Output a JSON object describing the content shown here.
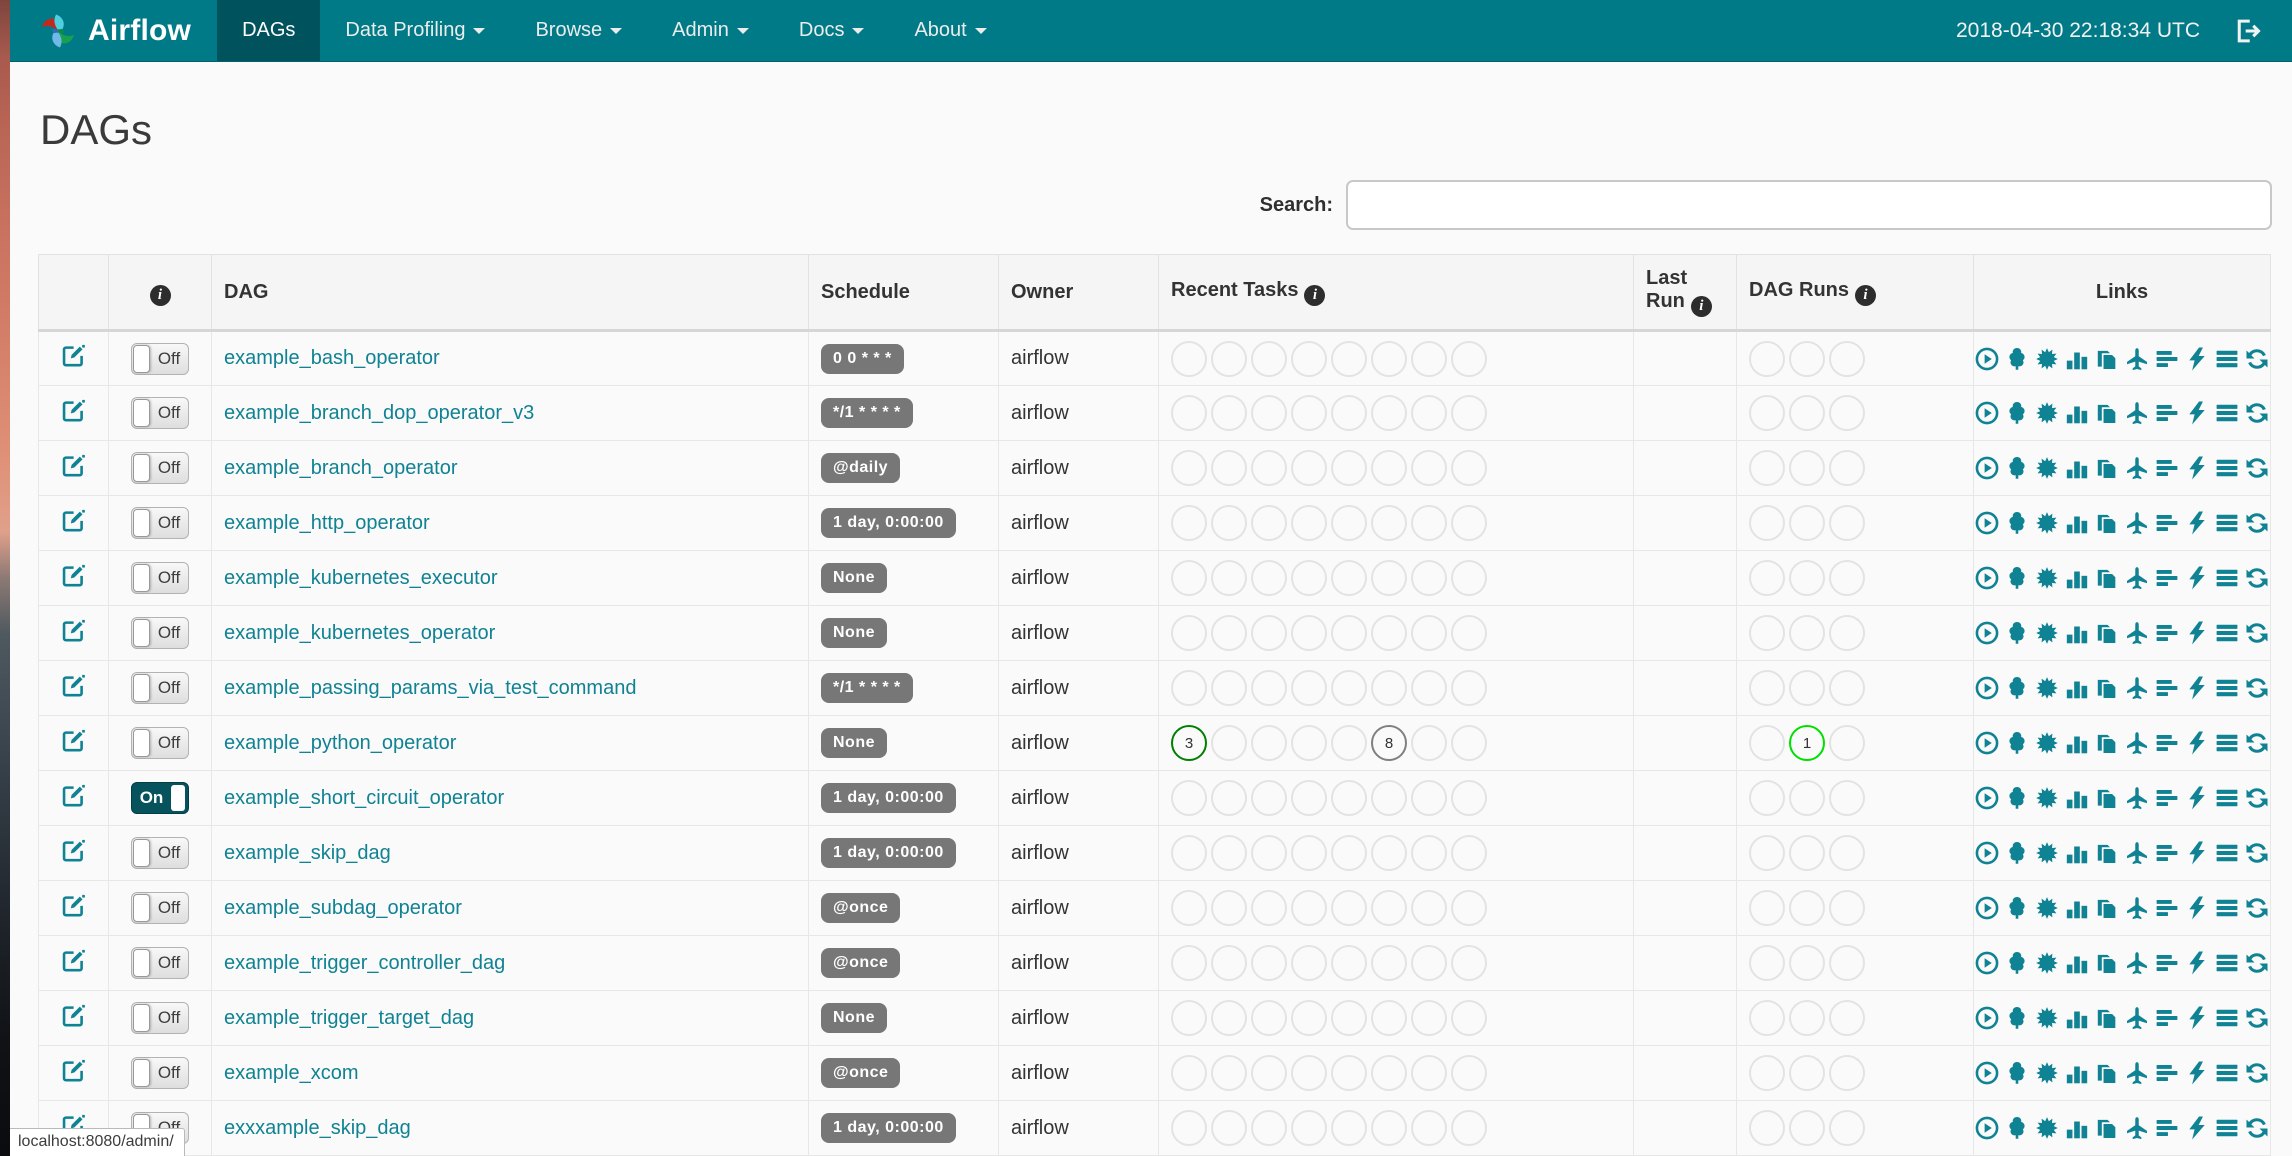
{
  "colors": {
    "navbar_bg": "#007a87",
    "navbar_active_bg": "#00525c",
    "accent_link": "#0f8293",
    "schedule_badge_bg": "#777777",
    "state_success": "#008000",
    "state_queued": "#808080",
    "state_running": "#00e000",
    "empty_circle_border": "#e3e3e3"
  },
  "navbar": {
    "brand": "Airflow",
    "logo_icon": "airflow-pinwheel-logo",
    "items": [
      {
        "label": "DAGs",
        "active": true,
        "caret": false
      },
      {
        "label": "Data Profiling",
        "active": false,
        "caret": true
      },
      {
        "label": "Browse",
        "active": false,
        "caret": true
      },
      {
        "label": "Admin",
        "active": false,
        "caret": true
      },
      {
        "label": "Docs",
        "active": false,
        "caret": true
      },
      {
        "label": "About",
        "active": false,
        "caret": true
      }
    ],
    "clock": "2018-04-30 22:18:34 UTC",
    "logout_icon": "sign-out"
  },
  "page": {
    "title": "DAGs",
    "search_label": "Search:",
    "search_value": "",
    "status_bar": "localhost:8080/admin/"
  },
  "table": {
    "headers": {
      "edit": "",
      "info_icon": "info-circle",
      "dag": "DAG",
      "schedule": "Schedule",
      "owner": "Owner",
      "recent_tasks": "Recent Tasks",
      "last_run": "Last Run",
      "dag_runs": "DAG Runs",
      "links": "Links"
    },
    "toggle_on_label": "On",
    "toggle_off_label": "Off",
    "link_icons": [
      "trigger-dag",
      "tree-view",
      "graph-view",
      "task-duration",
      "task-tries",
      "landing-times",
      "gantt",
      "code",
      "logs",
      "refresh"
    ],
    "rows": [
      {
        "dag_id": "example_bash_operator",
        "toggle": "Off",
        "schedule": "0 0 * * *",
        "owner": "airflow",
        "recent_tasks": [
          null,
          null,
          null,
          null,
          null,
          null,
          null,
          null
        ],
        "last_run": "",
        "dag_runs": [
          null,
          null,
          null
        ]
      },
      {
        "dag_id": "example_branch_dop_operator_v3",
        "toggle": "Off",
        "schedule": "*/1 * * * *",
        "owner": "airflow",
        "recent_tasks": [
          null,
          null,
          null,
          null,
          null,
          null,
          null,
          null
        ],
        "last_run": "",
        "dag_runs": [
          null,
          null,
          null
        ]
      },
      {
        "dag_id": "example_branch_operator",
        "toggle": "Off",
        "schedule": "@daily",
        "owner": "airflow",
        "recent_tasks": [
          null,
          null,
          null,
          null,
          null,
          null,
          null,
          null
        ],
        "last_run": "",
        "dag_runs": [
          null,
          null,
          null
        ]
      },
      {
        "dag_id": "example_http_operator",
        "toggle": "Off",
        "schedule": "1 day, 0:00:00",
        "owner": "airflow",
        "recent_tasks": [
          null,
          null,
          null,
          null,
          null,
          null,
          null,
          null
        ],
        "last_run": "",
        "dag_runs": [
          null,
          null,
          null
        ]
      },
      {
        "dag_id": "example_kubernetes_executor",
        "toggle": "Off",
        "schedule": "None",
        "owner": "airflow",
        "recent_tasks": [
          null,
          null,
          null,
          null,
          null,
          null,
          null,
          null
        ],
        "last_run": "",
        "dag_runs": [
          null,
          null,
          null
        ]
      },
      {
        "dag_id": "example_kubernetes_operator",
        "toggle": "Off",
        "schedule": "None",
        "owner": "airflow",
        "recent_tasks": [
          null,
          null,
          null,
          null,
          null,
          null,
          null,
          null
        ],
        "last_run": "",
        "dag_runs": [
          null,
          null,
          null
        ]
      },
      {
        "dag_id": "example_passing_params_via_test_command",
        "toggle": "Off",
        "schedule": "*/1 * * * *",
        "owner": "airflow",
        "recent_tasks": [
          null,
          null,
          null,
          null,
          null,
          null,
          null,
          null
        ],
        "last_run": "",
        "dag_runs": [
          null,
          null,
          null
        ]
      },
      {
        "dag_id": "example_python_operator",
        "toggle": "Off",
        "schedule": "None",
        "owner": "airflow",
        "recent_tasks": [
          {
            "count": 3,
            "state": "success",
            "color": "#008000"
          },
          null,
          null,
          null,
          null,
          {
            "count": 8,
            "state": "queued",
            "color": "#808080"
          },
          null,
          null
        ],
        "last_run": "",
        "dag_runs": [
          null,
          {
            "count": 1,
            "state": "running",
            "color": "#00e000"
          },
          null
        ]
      },
      {
        "dag_id": "example_short_circuit_operator",
        "toggle": "On",
        "schedule": "1 day, 0:00:00",
        "owner": "airflow",
        "recent_tasks": [
          null,
          null,
          null,
          null,
          null,
          null,
          null,
          null
        ],
        "last_run": "",
        "dag_runs": [
          null,
          null,
          null
        ]
      },
      {
        "dag_id": "example_skip_dag",
        "toggle": "Off",
        "schedule": "1 day, 0:00:00",
        "owner": "airflow",
        "recent_tasks": [
          null,
          null,
          null,
          null,
          null,
          null,
          null,
          null
        ],
        "last_run": "",
        "dag_runs": [
          null,
          null,
          null
        ]
      },
      {
        "dag_id": "example_subdag_operator",
        "toggle": "Off",
        "schedule": "@once",
        "owner": "airflow",
        "recent_tasks": [
          null,
          null,
          null,
          null,
          null,
          null,
          null,
          null
        ],
        "last_run": "",
        "dag_runs": [
          null,
          null,
          null
        ]
      },
      {
        "dag_id": "example_trigger_controller_dag",
        "toggle": "Off",
        "schedule": "@once",
        "owner": "airflow",
        "recent_tasks": [
          null,
          null,
          null,
          null,
          null,
          null,
          null,
          null
        ],
        "last_run": "",
        "dag_runs": [
          null,
          null,
          null
        ]
      },
      {
        "dag_id": "example_trigger_target_dag",
        "toggle": "Off",
        "schedule": "None",
        "owner": "airflow",
        "recent_tasks": [
          null,
          null,
          null,
          null,
          null,
          null,
          null,
          null
        ],
        "last_run": "",
        "dag_runs": [
          null,
          null,
          null
        ]
      },
      {
        "dag_id": "example_xcom",
        "toggle": "Off",
        "schedule": "@once",
        "owner": "airflow",
        "recent_tasks": [
          null,
          null,
          null,
          null,
          null,
          null,
          null,
          null
        ],
        "last_run": "",
        "dag_runs": [
          null,
          null,
          null
        ]
      },
      {
        "dag_id": "exxxample_skip_dag",
        "toggle": "Off",
        "schedule": "1 day, 0:00:00",
        "owner": "airflow",
        "recent_tasks": [
          null,
          null,
          null,
          null,
          null,
          null,
          null,
          null
        ],
        "last_run": "",
        "dag_runs": [
          null,
          null,
          null
        ]
      }
    ]
  }
}
